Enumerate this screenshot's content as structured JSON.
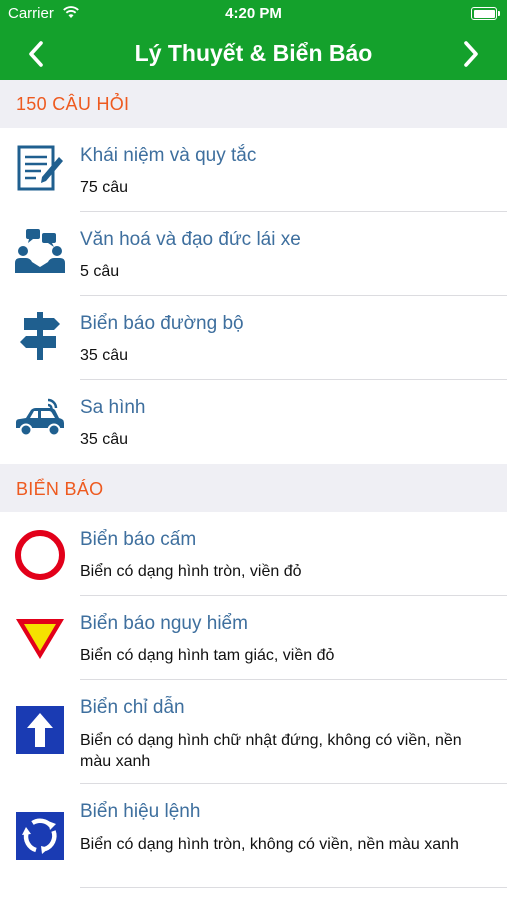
{
  "status_bar": {
    "carrier": "Carrier",
    "time": "4:20 PM"
  },
  "nav": {
    "title": "Lý Thuyết & Biển Báo"
  },
  "colors": {
    "nav_green": "#14a12c",
    "section_orange": "#ee5a1f",
    "title_blue": "#3e6f9e",
    "icon_blue": "#1f5f8f"
  },
  "sections": [
    {
      "header": "150 CÂU HỎI",
      "items": [
        {
          "icon": "document-pen-icon",
          "title": "Khái niệm và quy tắc",
          "subtitle": "75 câu"
        },
        {
          "icon": "people-chat-icon",
          "title": "Văn hoá và đạo đức lái xe",
          "subtitle": "5 câu"
        },
        {
          "icon": "signpost-icon",
          "title": "Biển báo đường bộ",
          "subtitle": "35 câu"
        },
        {
          "icon": "car-signal-icon",
          "title": "Sa hình",
          "subtitle": "35 câu"
        }
      ]
    },
    {
      "header": "BIỂN BÁO",
      "items": [
        {
          "icon": "prohibition-sign-icon",
          "title": "Biển báo cấm",
          "subtitle": "Biển có dạng hình tròn, viền đỏ"
        },
        {
          "icon": "warning-triangle-sign-icon",
          "title": "Biển báo nguy hiểm",
          "subtitle": "Biển có dạng hình tam giác, viền đỏ"
        },
        {
          "icon": "up-arrow-sign-icon",
          "title": "Biển chỉ dẫn",
          "subtitle": "Biển có dạng hình chữ nhật đứng, không có viền, nền màu xanh"
        },
        {
          "icon": "roundabout-sign-icon",
          "title": "Biển hiệu lệnh",
          "subtitle": "Biển có dạng hình tròn, không có viền, nền màu xanh"
        }
      ]
    }
  ]
}
